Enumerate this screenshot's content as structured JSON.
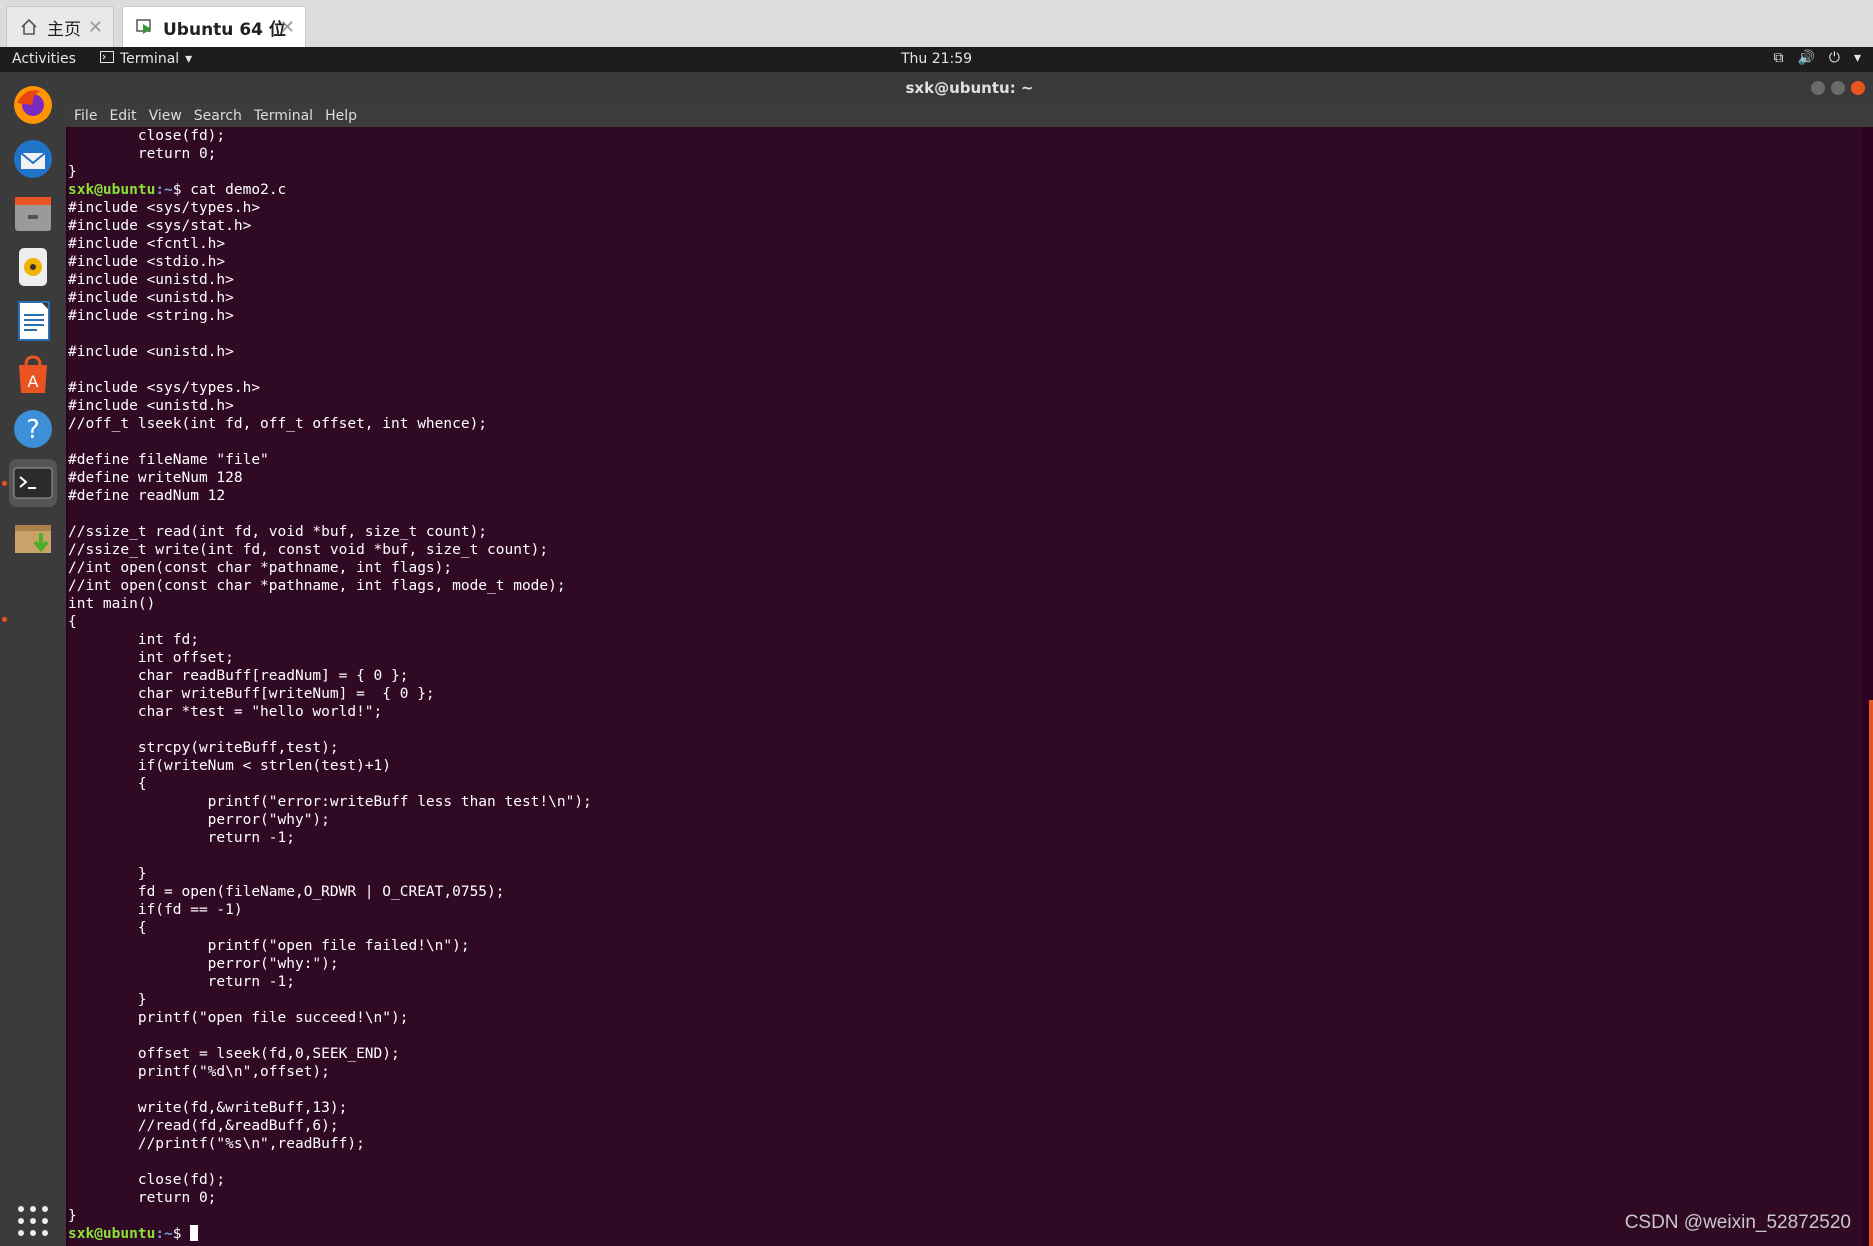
{
  "browser_tabs": [
    {
      "label": "主页",
      "icon": "home-icon",
      "active": false
    },
    {
      "label": "Ubuntu 64 位",
      "icon": "vm-icon",
      "active": true
    }
  ],
  "topbar": {
    "activities": "Activities",
    "app_menu": "Terminal",
    "clock": "Thu 21:59"
  },
  "window": {
    "title": "sxk@ubuntu: ~"
  },
  "menu": [
    "File",
    "Edit",
    "View",
    "Search",
    "Terminal",
    "Help"
  ],
  "dock": [
    "firefox-icon",
    "thunderbird-icon",
    "files-icon",
    "rhythmbox-icon",
    "libreoffice-writer-icon",
    "software-center-icon",
    "help-icon",
    "terminal-icon",
    "installer-icon",
    "show-apps-icon"
  ],
  "terminal": {
    "prompt_user": "sxk@ubuntu",
    "prompt_path": ":~",
    "prompt_symbol": "$ ",
    "command": "cat demo2.c",
    "lines_before": [
      "        close(fd);",
      "        return 0;",
      "}"
    ],
    "lines": [
      "#include <sys/types.h>",
      "#include <sys/stat.h>",
      "#include <fcntl.h>",
      "#include <stdio.h>",
      "#include <unistd.h>",
      "#include <unistd.h>",
      "#include <string.h>",
      "",
      "#include <unistd.h>",
      "",
      "#include <sys/types.h>",
      "#include <unistd.h>",
      "//off_t lseek(int fd, off_t offset, int whence);",
      "",
      "#define fileName \"file\"",
      "#define writeNum 128",
      "#define readNum 12",
      "",
      "//ssize_t read(int fd, void *buf, size_t count);",
      "//ssize_t write(int fd, const void *buf, size_t count);",
      "//int open(const char *pathname, int flags);",
      "//int open(const char *pathname, int flags, mode_t mode);",
      "int main()",
      "{",
      "        int fd;",
      "        int offset;",
      "        char readBuff[readNum] = { 0 };",
      "        char writeBuff[writeNum] =  { 0 };",
      "        char *test = \"hello world!\";",
      "",
      "        strcpy(writeBuff,test);",
      "        if(writeNum < strlen(test)+1)",
      "        {",
      "                printf(\"error:writeBuff less than test!\\n\");",
      "                perror(\"why\");",
      "                return -1;",
      "",
      "        }",
      "        fd = open(fileName,O_RDWR | O_CREAT,0755);",
      "        if(fd == -1)",
      "        {",
      "                printf(\"open file failed!\\n\");",
      "                perror(\"why:\");",
      "                return -1;",
      "        }",
      "        printf(\"open file succeed!\\n\");",
      "",
      "        offset = lseek(fd,0,SEEK_END);",
      "        printf(\"%d\\n\",offset);",
      "",
      "        write(fd,&writeBuff,13);",
      "        //read(fd,&readBuff,6);",
      "        //printf(\"%s\\n\",readBuff);",
      "",
      "        close(fd);",
      "        return 0;",
      "}"
    ]
  },
  "watermark": "CSDN @weixin_52872520",
  "colors": {
    "terminal_bg": "#300a24",
    "prompt_user": "#8ae234",
    "prompt_path": "#729fcf",
    "accent": "#e95420"
  }
}
